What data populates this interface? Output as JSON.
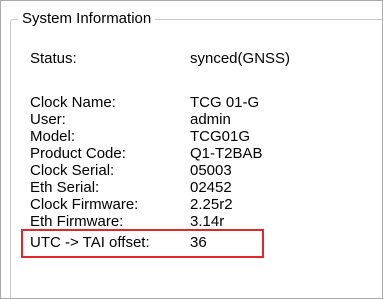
{
  "groupbox": {
    "title": "System Information"
  },
  "status": {
    "label": "Status:",
    "value": "synced(GNSS)"
  },
  "details": [
    {
      "label": "Clock Name:",
      "value": "TCG 01-G"
    },
    {
      "label": "User:",
      "value": "admin"
    },
    {
      "label": "Model:",
      "value": "TCG01G"
    },
    {
      "label": "Product Code:",
      "value": "Q1-T2BAB"
    },
    {
      "label": "Clock Serial:",
      "value": "05003"
    },
    {
      "label": "Eth Serial:",
      "value": "02452"
    },
    {
      "label": "Clock Firmware:",
      "value": "2.25r2"
    },
    {
      "label": "Eth Firmware:",
      "value": "3.14r"
    },
    {
      "label": "UTC -> TAI offset:",
      "value": "36"
    }
  ],
  "colors": {
    "highlight": "#e3262c",
    "border": "#a9a9a9"
  }
}
